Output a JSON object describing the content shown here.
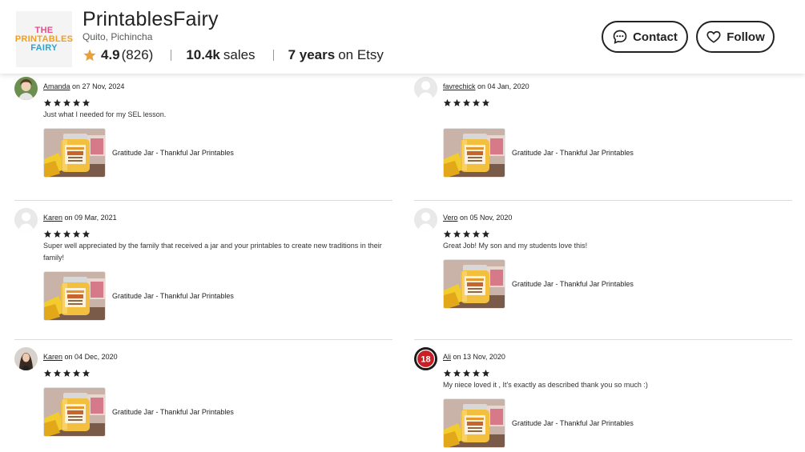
{
  "shop": {
    "logo_lines": [
      "THE",
      "PRINTABLES",
      "FAIRY"
    ],
    "name": "PrintablesFairy",
    "location": "Quito, Pichincha",
    "rating": "4.9",
    "rating_count": "(826)",
    "sales_value": "10.4k",
    "sales_label": "sales",
    "years_value": "7 years",
    "years_label": "on Etsy",
    "contact_label": "Contact",
    "follow_label": "Follow"
  },
  "reviews": [
    {
      "name": "Amanda",
      "date": "on 27 Nov, 2024",
      "stars": 5,
      "text": "Just what I needed for my SEL lesson.",
      "product": "Gratitude Jar - Thankful Jar Printables",
      "avatar": "photo-woman-green"
    },
    {
      "name": "favrechick",
      "date": "on 04 Jan, 2020",
      "stars": 5,
      "text": "",
      "product": "Gratitude Jar - Thankful Jar Printables",
      "avatar": "default-user"
    },
    {
      "name": "Karen",
      "date": "on 09 Mar, 2021",
      "stars": 5,
      "text": "Super well appreciated by the family that received a jar and your printables to create new traditions in their family!",
      "product": "Gratitude Jar - Thankful Jar Printables",
      "avatar": "default-user"
    },
    {
      "name": "Vero",
      "date": "on 05 Nov, 2020",
      "stars": 5,
      "text": "Great Job! My son and my students love this!",
      "product": "Gratitude Jar - Thankful Jar Printables",
      "avatar": "default-user"
    },
    {
      "name": "Karen",
      "date": "on 04 Dec, 2020",
      "stars": 5,
      "text": "",
      "product": "Gratitude Jar - Thankful Jar Printables",
      "avatar": "photo-woman-dark-hair"
    },
    {
      "name": "Ali",
      "date": "on 13 Nov, 2020",
      "stars": 5,
      "text": "My niece loved it , It's exactly as described thank you so much :)",
      "product": "Gratitude Jar - Thankful Jar Printables",
      "avatar": "badge-18"
    }
  ],
  "avatar_badge_text": "18",
  "colors": {
    "star_gold": "#e8a13a",
    "text": "#222222",
    "divider": "#dddddd"
  }
}
